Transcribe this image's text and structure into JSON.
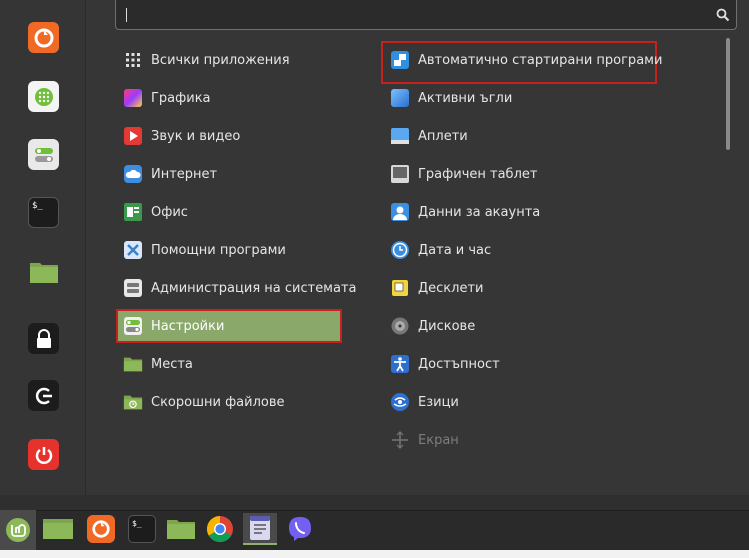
{
  "search": {
    "value": "",
    "placeholder": ""
  },
  "favorites": [
    {
      "icon": "firefox-icon"
    },
    {
      "icon": "software-manager-icon"
    },
    {
      "icon": "settings-toggle-icon"
    },
    {
      "icon": "terminal-icon",
      "glyph": "$_"
    },
    {
      "icon": "folder-icon"
    },
    {
      "icon": "lock-icon"
    },
    {
      "icon": "logout-icon"
    },
    {
      "icon": "power-icon"
    }
  ],
  "categories": [
    {
      "label": "Всички приложения",
      "icon": "grid-icon"
    },
    {
      "label": "Графика",
      "icon": "graphics-icon"
    },
    {
      "label": "Звук и видео",
      "icon": "play-icon"
    },
    {
      "label": "Интернет",
      "icon": "cloud-icon"
    },
    {
      "label": "Офис",
      "icon": "office-icon"
    },
    {
      "label": "Помощни програми",
      "icon": "utilities-icon"
    },
    {
      "label": "Администрация на системата",
      "icon": "admin-icon"
    },
    {
      "label": "Настройки",
      "icon": "settings-icon",
      "selected": true
    },
    {
      "label": "Места",
      "icon": "folder-icon"
    },
    {
      "label": "Скорошни файлове",
      "icon": "recent-folder-icon"
    }
  ],
  "applets": [
    {
      "label": "Автоматично стартирани програми",
      "icon": "startup-apps-icon",
      "highlighted": true
    },
    {
      "label": "Активни ъгли",
      "icon": "hot-corners-icon"
    },
    {
      "label": "Аплети",
      "icon": "applets-icon"
    },
    {
      "label": "Графичен таблет",
      "icon": "tablet-icon"
    },
    {
      "label": "Данни за акаунта",
      "icon": "account-icon"
    },
    {
      "label": "Дата и час",
      "icon": "clock-icon"
    },
    {
      "label": "Десклети",
      "icon": "desklets-icon"
    },
    {
      "label": "Дискове",
      "icon": "disks-icon"
    },
    {
      "label": "Достъпност",
      "icon": "accessibility-icon"
    },
    {
      "label": "Езици",
      "icon": "languages-icon"
    },
    {
      "label": "Екран",
      "icon": "display-icon",
      "dimmed": true
    }
  ],
  "taskbar": [
    {
      "icon": "mint-menu-icon"
    },
    {
      "icon": "show-desktop-icon"
    },
    {
      "icon": "firefox-icon"
    },
    {
      "icon": "terminal-icon",
      "glyph": "$_"
    },
    {
      "icon": "folder-icon"
    },
    {
      "icon": "chrome-icon"
    },
    {
      "icon": "text-editor-icon",
      "active": true
    },
    {
      "icon": "viber-icon"
    }
  ],
  "colors": {
    "accent_green": "#8aa86a",
    "highlight_red": "#c8201c",
    "firefox_orange": "#f06a25",
    "power_red": "#e5322d"
  }
}
